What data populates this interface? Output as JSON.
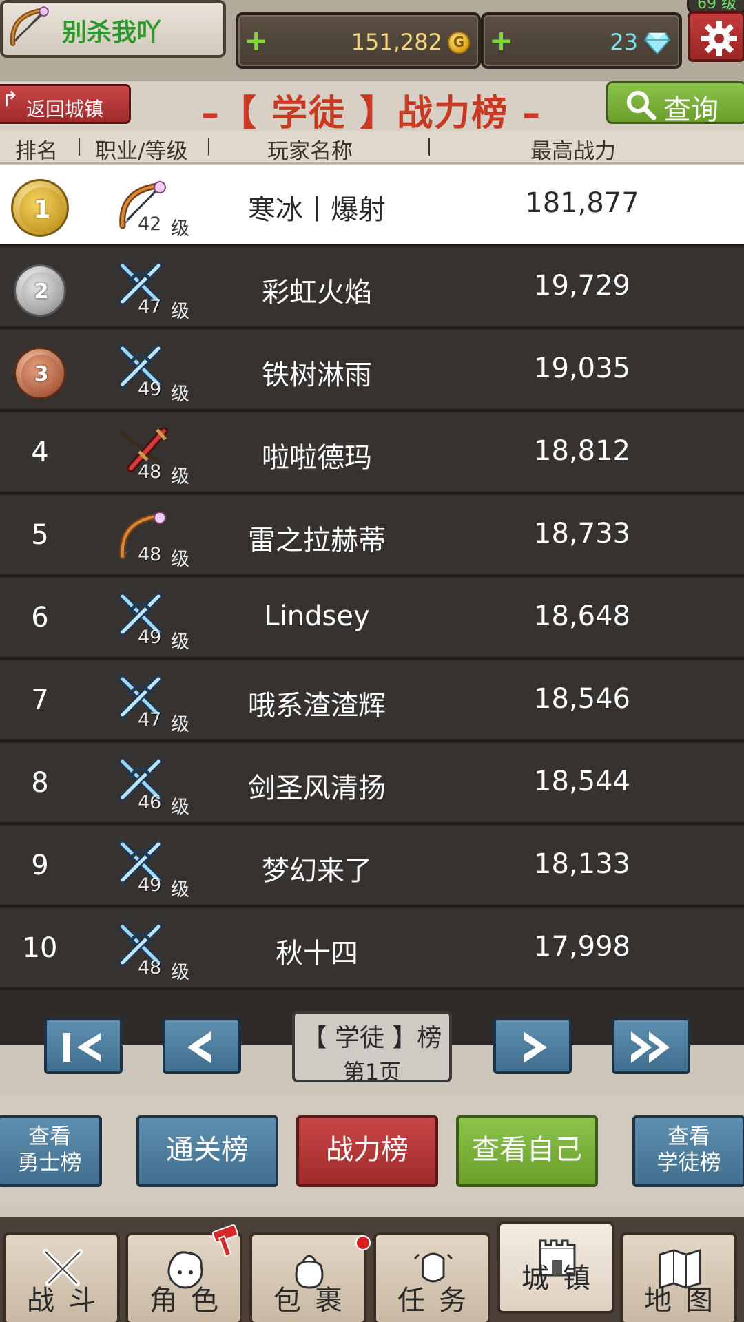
{
  "header": {
    "player_name": "别杀我吖",
    "player_level": "69 级",
    "gold": "151,282",
    "gold_icon_letter": "G",
    "gems": "23",
    "add_symbol": "+"
  },
  "titlebar": {
    "back_label": "返回城镇",
    "title": "–【 学徒 】战力榜 –",
    "query_label": "查询"
  },
  "columns": {
    "rank": "排名",
    "class_level": "职业/等级",
    "player_name": "玩家名称",
    "max_power": "最高战力"
  },
  "level_unit": "级",
  "rows": [
    {
      "rank": "1",
      "class": "archer",
      "level": "42",
      "name": "寒冰丨爆射",
      "power": "181,877"
    },
    {
      "rank": "2",
      "class": "swordsman",
      "level": "47",
      "name": "彩虹火焰",
      "power": "19,729"
    },
    {
      "rank": "3",
      "class": "swordsman",
      "level": "49",
      "name": "铁树淋雨",
      "power": "19,035"
    },
    {
      "rank": "4",
      "class": "warrior",
      "level": "48",
      "name": "啦啦德玛",
      "power": "18,812"
    },
    {
      "rank": "5",
      "class": "archer",
      "level": "48",
      "name": "雷之拉赫蒂",
      "power": "18,733"
    },
    {
      "rank": "6",
      "class": "swordsman",
      "level": "49",
      "name": "Lindsey",
      "power": "18,648"
    },
    {
      "rank": "7",
      "class": "swordsman",
      "level": "47",
      "name": "哦系渣渣辉",
      "power": "18,546"
    },
    {
      "rank": "8",
      "class": "swordsman",
      "level": "46",
      "name": "剑圣风清扬",
      "power": "18,544"
    },
    {
      "rank": "9",
      "class": "swordsman",
      "level": "49",
      "name": "梦幻来了",
      "power": "18,133"
    },
    {
      "rank": "10",
      "class": "swordsman",
      "level": "48",
      "name": "秋十四",
      "power": "17,998"
    }
  ],
  "pager": {
    "board_label": "【 学徒 】榜",
    "page_label": "第1页"
  },
  "boards": {
    "warrior_board": [
      "查看",
      "勇士榜"
    ],
    "clear_board": "通关榜",
    "power_board": "战力榜",
    "view_self": "查看自己",
    "apprentice_board": [
      "查看",
      "学徒榜"
    ]
  },
  "nav": {
    "battle": "战斗",
    "character": "角色",
    "inventory": "包裹",
    "quests": "任务",
    "town": "城镇",
    "map": "地图"
  },
  "colors": {
    "title_red": "#c83a22",
    "button_blue": "#4f7f9f",
    "button_red": "#b63838",
    "button_green": "#7cb23b",
    "row_dark": "#363230"
  }
}
